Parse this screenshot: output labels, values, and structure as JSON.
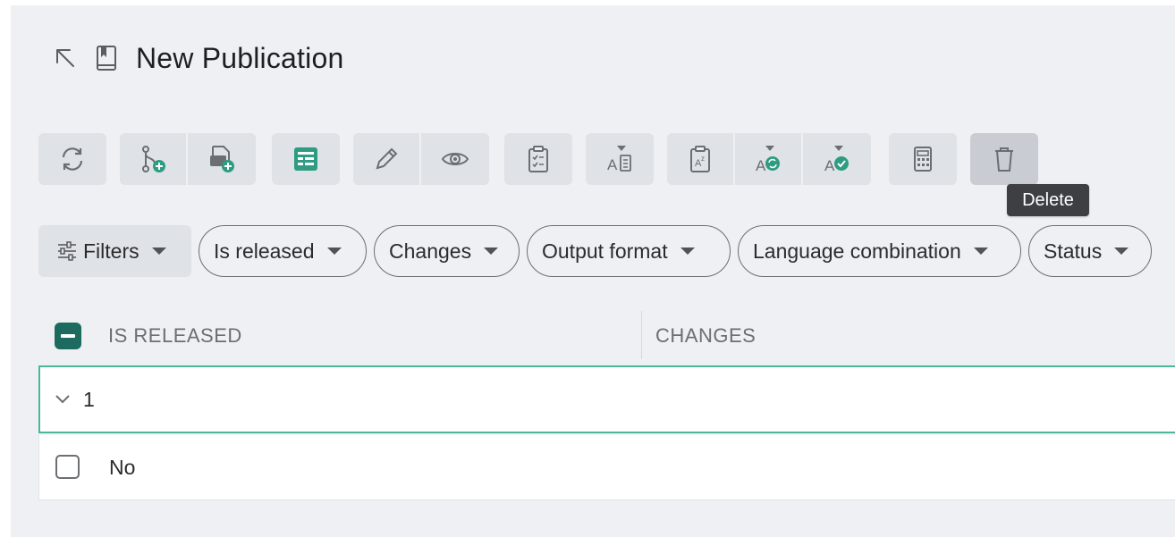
{
  "header": {
    "title": "New Publication",
    "icons": [
      "arrow-up-left-icon",
      "book-icon"
    ]
  },
  "toolbar": {
    "groups": [
      [
        "refresh-icon"
      ],
      [
        "branch-add-icon",
        "file-add-icon"
      ],
      [
        "table-view-icon"
      ],
      [
        "pencil-icon",
        "eye-icon"
      ],
      [
        "clipboard-checklist-icon"
      ],
      [
        "language-text-icon"
      ],
      [
        "clipboard-translate-icon",
        "language-sync-icon",
        "language-check-icon"
      ],
      [
        "calculator-icon"
      ],
      [
        "trash-icon"
      ]
    ],
    "active": "trash-icon"
  },
  "tooltip": {
    "text": "Delete"
  },
  "filters": {
    "main_label": "Filters",
    "chips": [
      "Is released",
      "Changes",
      "Output format",
      "Language combination",
      "Status"
    ]
  },
  "table": {
    "columns": [
      "IS RELEASED",
      "CHANGES"
    ],
    "group": {
      "label": "1"
    },
    "rows": [
      {
        "is_released": "No"
      }
    ]
  },
  "colors": {
    "accent": "#1d6b5e",
    "accent_light": "#4cb69b",
    "panel_bg": "#eef0f3",
    "button_bg": "#dfe2e7"
  }
}
